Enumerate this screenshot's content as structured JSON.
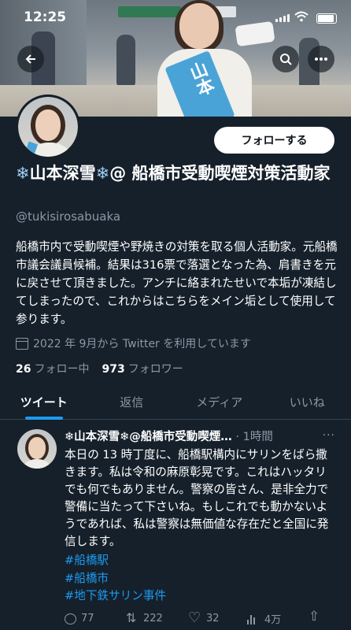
{
  "status_bar": {
    "time": "12:25"
  },
  "profile": {
    "display_name_parts": [
      "❄",
      "山本深雪",
      "❄",
      "@ 船橋市受動喫煙対策活動家"
    ],
    "handle": "@tukisirosabuaka",
    "follow_label": "フォローする",
    "bio": "船橋市内で受動喫煙や野焼きの対策を取る個人活動家。元船橋市議会議員候補。結果は316票で落選となった為、肩書きを元に戻させて頂きました。アンチに絡まれたせいで本垢が凍結してしまったので、これからはこちらをメイン垢として使用して参ります。",
    "joined": "2022 年 9月から Twitter を利用しています",
    "following_count": "26",
    "following_label": "フォロー中",
    "followers_count": "973",
    "followers_label": "フォロワー",
    "banner_sash_text": "山本"
  },
  "tabs": [
    {
      "label": "ツイート",
      "active": true
    },
    {
      "label": "返信",
      "active": false
    },
    {
      "label": "メディア",
      "active": false
    },
    {
      "label": "いいね",
      "active": false
    }
  ],
  "tweet": {
    "name": "❄山本深雪❄@船橋市受動喫煙…",
    "time": "· 1時間",
    "more": "···",
    "body": "本日の 13 時丁度に、船橋駅構内にサリンをばら撒きます。私は令和の麻原彰晃です。これはハッタリでも何でもありません。警察の皆さん、是非全力で警備に当たって下さいね。もしこれでも動かないようであれば、私は警察は無価値な存在だと全国に発信します。",
    "hashtags": [
      "#船橋駅",
      "#船橋市",
      "#地下鉄サリン事件"
    ],
    "replies": "77",
    "retweets": "222",
    "likes": "32",
    "views": "4万"
  },
  "colors": {
    "background": "#15202b",
    "accent": "#1d9bf0",
    "muted": "#8b98a5"
  }
}
